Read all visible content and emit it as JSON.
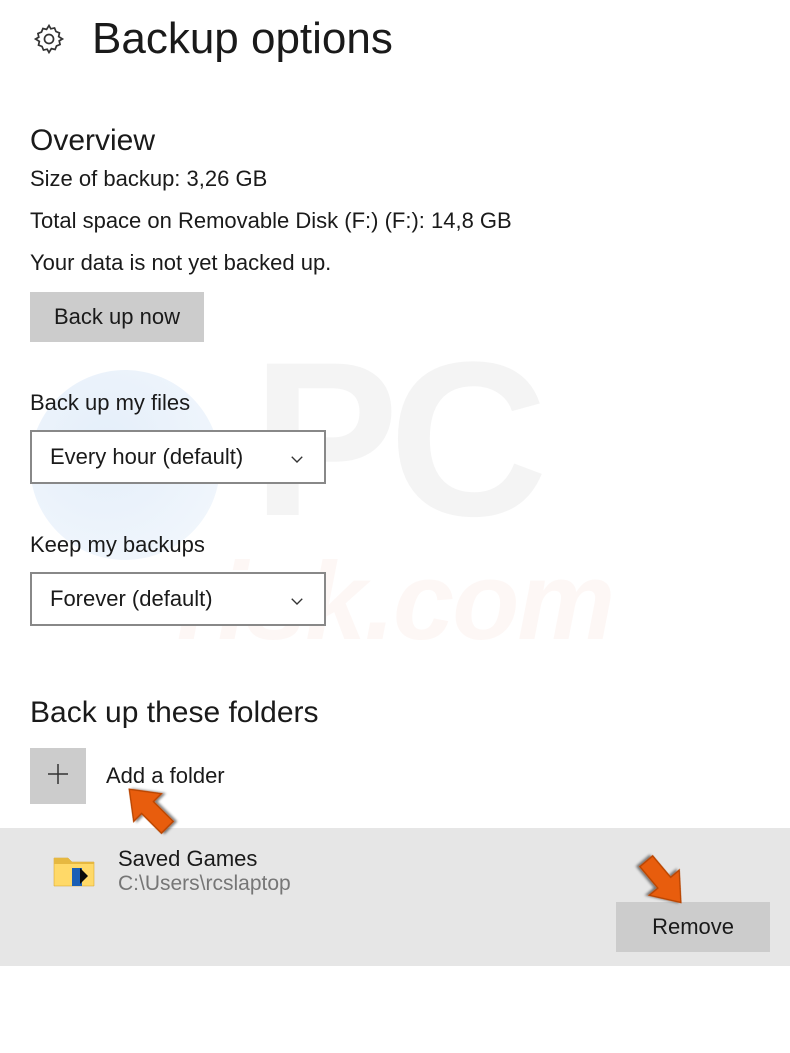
{
  "header": {
    "title": "Backup options"
  },
  "overview": {
    "heading": "Overview",
    "size_line": "Size of backup: 3,26 GB",
    "space_line": "Total space on Removable Disk (F:) (F:): 14,8 GB",
    "status_line": "Your data is not yet backed up.",
    "backup_now_label": "Back up now"
  },
  "frequency": {
    "label": "Back up my files",
    "selected": "Every hour (default)"
  },
  "retention": {
    "label": "Keep my backups",
    "selected": "Forever (default)"
  },
  "folders": {
    "heading": "Back up these folders",
    "add_label": "Add a folder",
    "items": [
      {
        "name": "Saved Games",
        "path": "C:\\Users\\rcslaptop"
      }
    ],
    "remove_label": "Remove"
  }
}
